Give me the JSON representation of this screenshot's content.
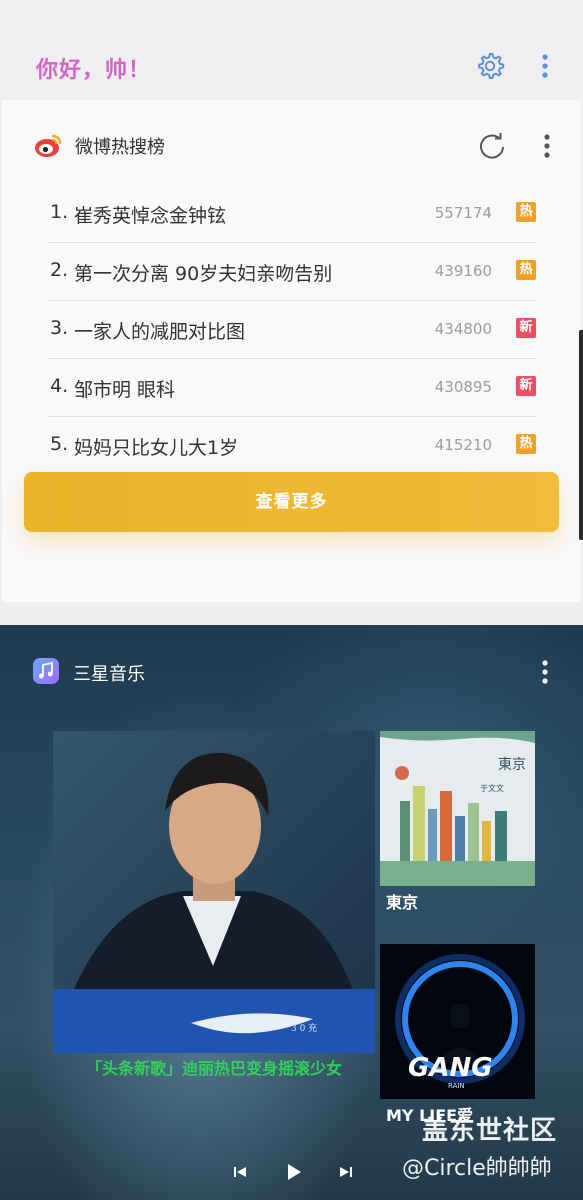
{
  "header": {
    "greeting": "你好，帅！",
    "settings_icon": "gear-icon",
    "more_icon": "more-vertical-icon"
  },
  "weibo": {
    "title": "微博热搜榜",
    "logo_icon": "weibo-logo",
    "refresh_icon": "refresh-icon",
    "more_icon": "more-vertical-icon",
    "items": [
      {
        "rank": "1.",
        "title": "崔秀英悼念金钟铉",
        "count": "557174",
        "badge": "热",
        "badge_color": "#f0a026"
      },
      {
        "rank": "2.",
        "title": "第一次分离 90岁夫妇亲吻告别",
        "count": "439160",
        "badge": "热",
        "badge_color": "#f0a026"
      },
      {
        "rank": "3.",
        "title": "一家人的减肥对比图",
        "count": "434800",
        "badge": "新",
        "badge_color": "#ee4d5e"
      },
      {
        "rank": "4.",
        "title": "邹市明 眼科",
        "count": "430895",
        "badge": "新",
        "badge_color": "#ee4d5e"
      },
      {
        "rank": "5.",
        "title": "妈妈只比女儿大1岁",
        "count": "415210",
        "badge": "热",
        "badge_color": "#f0a026"
      }
    ],
    "more_button": "查看更多",
    "accent_color": "#ecb22a"
  },
  "music": {
    "title": "三星音乐",
    "logo_icon": "samsung-music-icon",
    "more_icon": "more-vertical-icon",
    "main_album": {
      "caption": "「头条新歌」迪丽热巴变身摇滚少女",
      "cover_text": "3 0 充"
    },
    "albums": [
      {
        "title": "東京",
        "cover_title": "東京",
        "cover_artist": "于文文"
      },
      {
        "title": "MY LIFE爱",
        "cover_title": "GANG",
        "cover_artist": "RAIN"
      }
    ],
    "controls": {
      "prev": "previous-icon",
      "play": "play-icon",
      "next": "next-icon"
    }
  },
  "watermark": {
    "line1": "盖东世社区",
    "line2": "@Circle帥帥帥"
  }
}
